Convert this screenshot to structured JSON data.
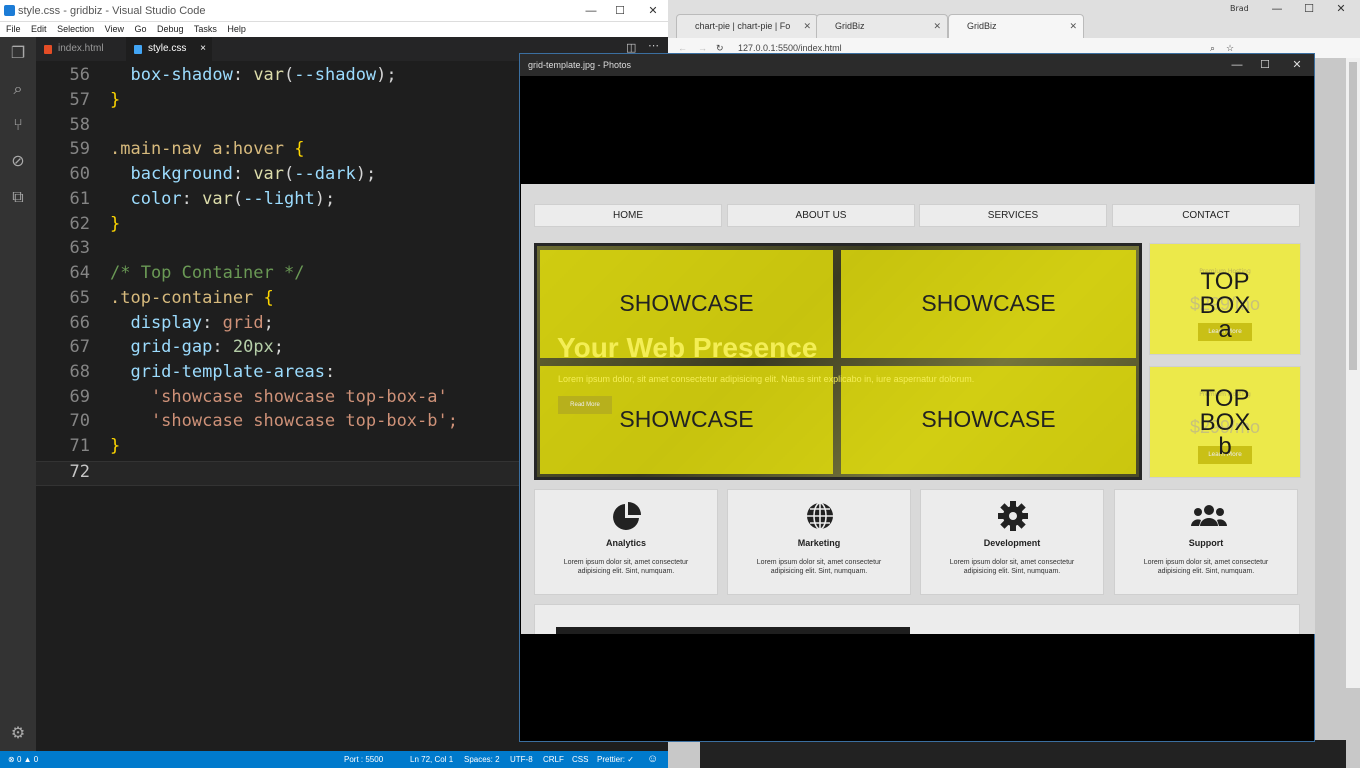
{
  "vscode": {
    "title": "style.css - gridbiz - Visual Studio Code",
    "menu": [
      "File",
      "Edit",
      "Selection",
      "View",
      "Go",
      "Debug",
      "Tasks",
      "Help"
    ],
    "tabs": [
      {
        "label": "index.html"
      },
      {
        "label": "style.css",
        "close": "×"
      }
    ],
    "lines": [
      {
        "n": "56",
        "code": "  box-shadow: var(--shadow);"
      },
      {
        "n": "57",
        "code": "}"
      },
      {
        "n": "58",
        "code": ""
      },
      {
        "n": "59",
        "code": ".main-nav a:hover {"
      },
      {
        "n": "60",
        "code": "  background: var(--dark);"
      },
      {
        "n": "61",
        "code": "  color: var(--light);"
      },
      {
        "n": "62",
        "code": "}"
      },
      {
        "n": "63",
        "code": ""
      },
      {
        "n": "64",
        "code": "/* Top Container */"
      },
      {
        "n": "65",
        "code": ".top-container {"
      },
      {
        "n": "66",
        "code": "  display: grid;"
      },
      {
        "n": "67",
        "code": "  grid-gap: 20px;"
      },
      {
        "n": "68",
        "code": "  grid-template-areas:"
      },
      {
        "n": "69",
        "code": "    'showcase showcase top-box-a'"
      },
      {
        "n": "70",
        "code": "    'showcase showcase top-box-b';"
      },
      {
        "n": "71",
        "code": "}"
      },
      {
        "n": "72",
        "code": ""
      }
    ],
    "status": {
      "errors": "0",
      "warnings": "0",
      "port": "Port : 5500",
      "position": "Ln 72, Col 1",
      "spaces": "Spaces: 2",
      "encoding": "UTF-8",
      "eol": "CRLF",
      "language": "CSS",
      "prettier": "Prettier: ✓"
    }
  },
  "browser": {
    "tabs": [
      {
        "label": "chart-pie | chart-pie | Fo"
      },
      {
        "label": "GridBiz"
      },
      {
        "label": "GridBiz"
      }
    ],
    "url": "127.0.0.1:5500/index.html",
    "user": "Brad"
  },
  "photos": {
    "title": "grid-template.jpg - Photos",
    "nav": [
      "HOME",
      "ABOUT US",
      "SERVICES",
      "CONTACT"
    ],
    "showcase_label": "SHOWCASE",
    "hero_title": "Your Web Presence",
    "hero_text": "Lorem ipsum dolor, sit amet consectetur adipisicing elit. Natus sint explicabo in, iure aspernatur dolorum.",
    "hero_button": "Read More",
    "top_box_a": "TOP BOX a",
    "top_box_b": "TOP BOX b",
    "top_box_price": "$299/mo",
    "top_box_small": "Premium Hosting",
    "top_box_button": "Learn More",
    "features": [
      {
        "title": "Analytics",
        "text": "Lorem ipsum dolor sit, amet consectetur adipisicing elit. Sint, numquam.",
        "icon": "chart-pie-icon"
      },
      {
        "title": "Marketing",
        "text": "Lorem ipsum dolor sit, amet consectetur adipisicing elit. Sint, numquam.",
        "icon": "globe-icon"
      },
      {
        "title": "Development",
        "text": "Lorem ipsum dolor sit, amet consectetur adipisicing elit. Sint, numquam.",
        "icon": "cog-icon"
      },
      {
        "title": "Support",
        "text": "Lorem ipsum dolor sit, amet consectetur adipisicing elit. Sint, numquam.",
        "icon": "users-icon"
      }
    ]
  }
}
